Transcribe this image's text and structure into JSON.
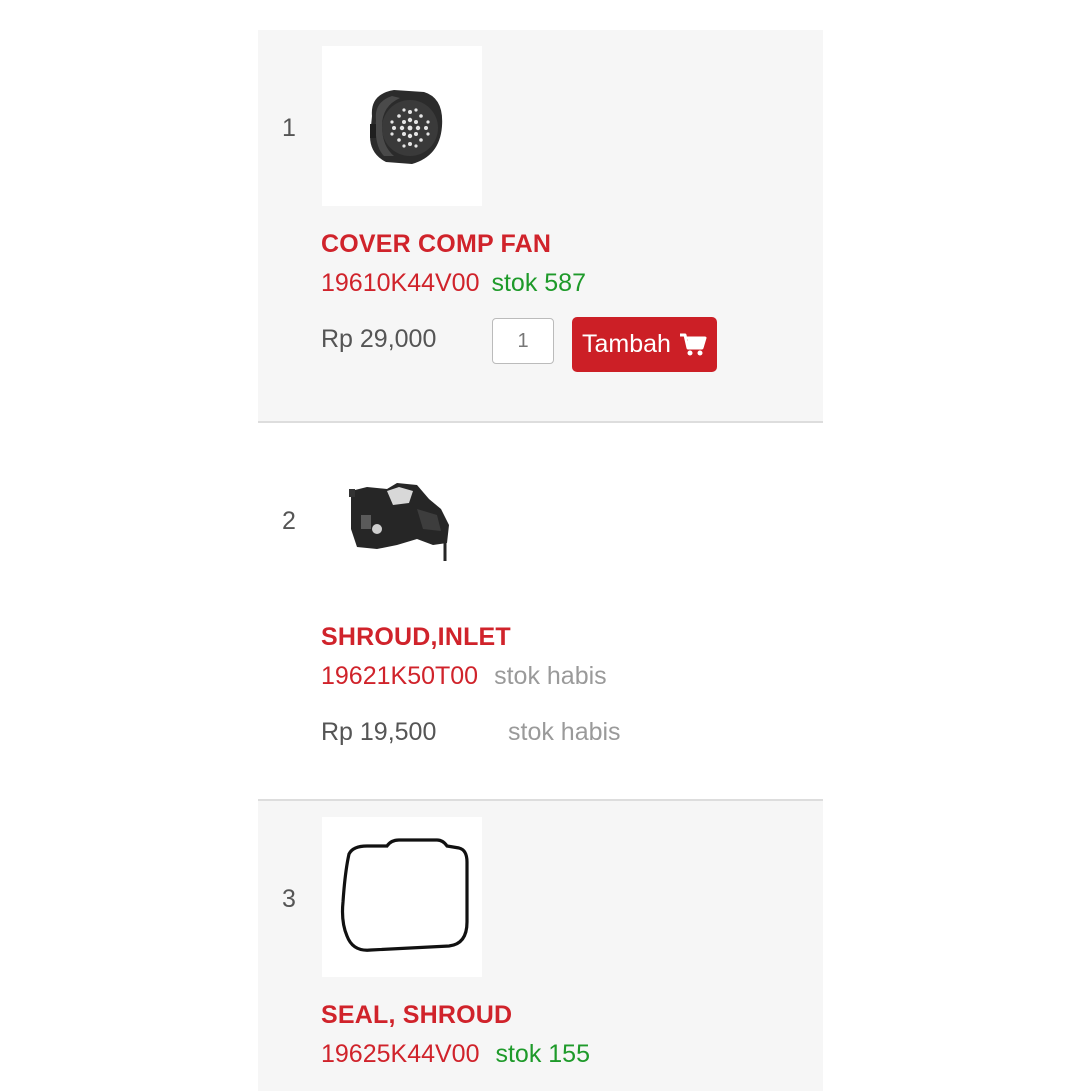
{
  "products": [
    {
      "index": "1",
      "name": "COVER COMP FAN",
      "code": "19610K44V00",
      "stock": "stok 587",
      "price": "Rp 29,000",
      "qty": "1",
      "add_label": "Tambah",
      "add_icon": "cart-icon",
      "image_icon": "fan-cover-image"
    },
    {
      "index": "2",
      "name": "SHROUD,INLET",
      "code": "19621K50T00",
      "stock": "stok habis",
      "price": "Rp 19,500",
      "status": "stok habis",
      "image_icon": "shroud-inlet-image"
    },
    {
      "index": "3",
      "name": "SEAL, SHROUD",
      "code": "19625K44V00",
      "stock": "stok 155",
      "image_icon": "seal-shroud-image"
    }
  ],
  "colors": {
    "name_red": "#d0232b",
    "button_red": "#cc1f26",
    "stock_green": "#1e9a2a",
    "stock_grey": "#9a9a9a",
    "row_bg": "#f6f6f6"
  }
}
